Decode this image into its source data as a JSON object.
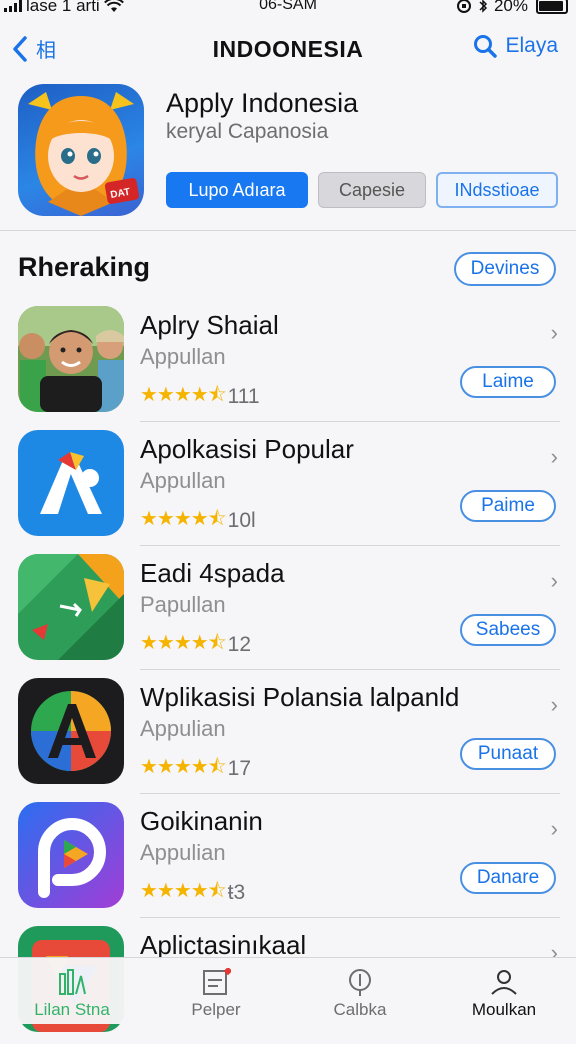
{
  "status": {
    "carrier": "lase 1 arti",
    "time": "06-SAM",
    "battery": "20%"
  },
  "nav": {
    "back_label": "相",
    "title": "INDOONESIA",
    "right_label": "Elaya"
  },
  "hero": {
    "title": "Apply Indonesia",
    "subtitle": "keryal Capanosia",
    "badge": "DAT",
    "buttons": [
      "Lupo Adıara",
      "Capesie",
      "INdsstioae"
    ]
  },
  "section": {
    "title": "Rheraking",
    "action": "Devines"
  },
  "apps": [
    {
      "name": "Aplry Shaial",
      "developer": "Appullan",
      "rating": 4.5,
      "count": "111",
      "button": "Laime",
      "icon": "kids-photo-icon"
    },
    {
      "name": "Apolkasisi Popular",
      "developer": "Appullan",
      "rating": 4.5,
      "count": "10l",
      "button": "Paime",
      "icon": "colorful-a-logo-icon"
    },
    {
      "name": "Eadi 4spada",
      "developer": "Papullan",
      "rating": 4.5,
      "count": "12",
      "button": "Sabees",
      "icon": "green-arrow-icon"
    },
    {
      "name": "Wplikasisi Polansia lalpanld",
      "developer": "Appulian",
      "rating": 4.5,
      "count": "17",
      "button": "Punaat",
      "icon": "gradient-a-icon"
    },
    {
      "name": "Goikinanin",
      "developer": "Appulian",
      "rating": 4.5,
      "count": "ŧ3",
      "button": "Danare",
      "icon": "play-p-icon"
    },
    {
      "name": "Aplictasinıkaal",
      "developer": "",
      "rating": null,
      "count": "",
      "button": "",
      "icon": "red-tile-icon"
    }
  ],
  "tabs": [
    {
      "label": "Lilan Stna",
      "icon": "bars-icon",
      "active": true
    },
    {
      "label": "Pelper",
      "icon": "document-icon",
      "active": false
    },
    {
      "label": "Calbka",
      "icon": "compass-icon",
      "active": false
    },
    {
      "label": "Moulkan",
      "icon": "profile-icon",
      "active": false
    }
  ],
  "colors": {
    "accent": "#1a73e8",
    "primary_button": "#1778f2",
    "star": "#f5b400",
    "active_tab": "#33b36a"
  }
}
